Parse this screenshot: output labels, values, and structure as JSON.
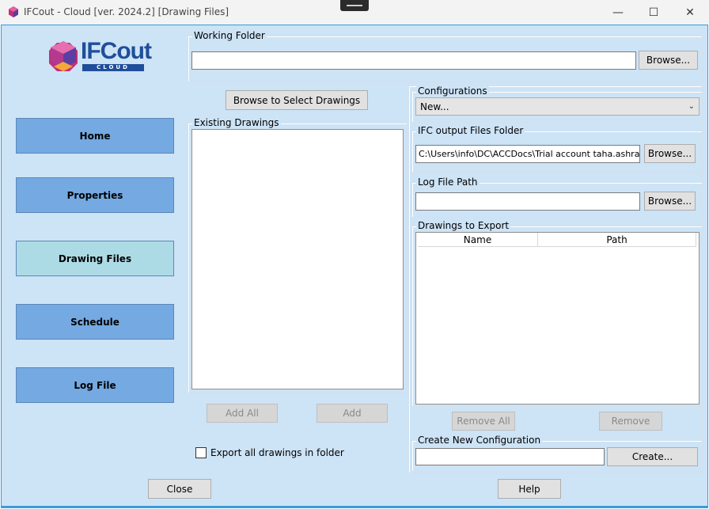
{
  "window": {
    "title": "IFCout - Cloud [ver. 2024.2]  [Drawing Files]",
    "minimize": "—",
    "maximize": "☐",
    "close": "✕"
  },
  "logo": {
    "text": "IFCout",
    "subtext": "CLOUD"
  },
  "nav": {
    "home": "Home",
    "properties": "Properties",
    "drawing_files": "Drawing Files",
    "schedule": "Schedule",
    "log_file": "Log File",
    "active": "drawing_files"
  },
  "working_folder": {
    "label": "Working Folder",
    "value": "",
    "browse": "Browse..."
  },
  "drawings": {
    "browse_select": "Browse to Select Drawings",
    "existing_label": "Existing Drawings",
    "add_all": "Add All",
    "add": "Add",
    "export_all_label": "Export all drawings in folder",
    "export_all_checked": false
  },
  "configurations": {
    "label": "Configurations",
    "selected": "New..."
  },
  "ifc_output": {
    "label": "IFC output Files Folder",
    "value": "C:\\Users\\info\\DC\\ACCDocs\\Trial account taha.ashraf@",
    "browse": "Browse..."
  },
  "log_path": {
    "label": "Log File Path",
    "value": "",
    "browse": "Browse..."
  },
  "export_list": {
    "label": "Drawings to Export",
    "columns": [
      "Name",
      "Path"
    ],
    "remove_all": "Remove All",
    "remove": "Remove"
  },
  "new_config": {
    "label": "Create New Configuration",
    "value": "",
    "create": "Create..."
  },
  "footer": {
    "close": "Close",
    "help": "Help"
  },
  "colors": {
    "background": "#cde3f6",
    "nav": "#74a9e1",
    "nav_active": "#acdbe6",
    "border_accent": "#3a9bdc"
  }
}
